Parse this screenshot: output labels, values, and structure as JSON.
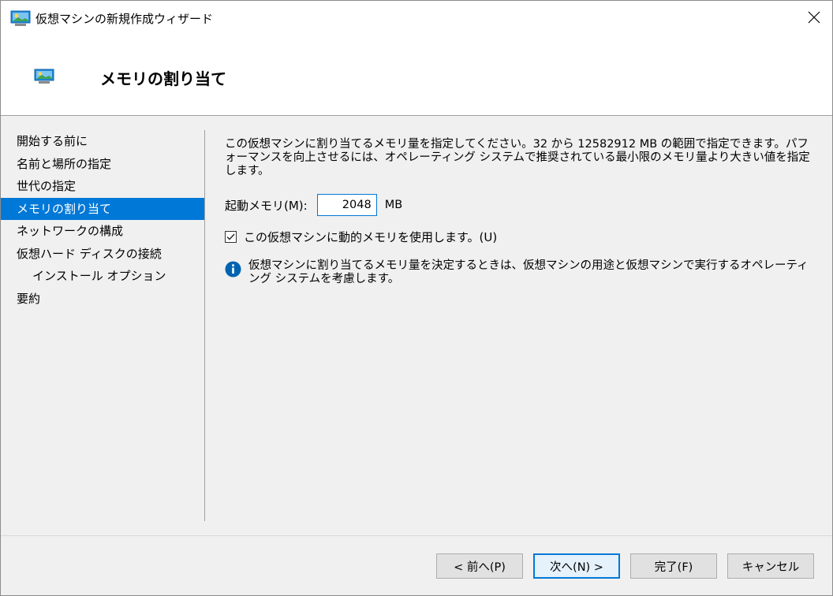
{
  "window": {
    "title": "仮想マシンの新規作成ウィザード",
    "close_glyph": "✕"
  },
  "header": {
    "title": "メモリの割り当て"
  },
  "nav": {
    "items": [
      {
        "label": "開始する前に",
        "selected": false,
        "indent": false
      },
      {
        "label": "名前と場所の指定",
        "selected": false,
        "indent": false
      },
      {
        "label": "世代の指定",
        "selected": false,
        "indent": false
      },
      {
        "label": "メモリの割り当て",
        "selected": true,
        "indent": false
      },
      {
        "label": "ネットワークの構成",
        "selected": false,
        "indent": false
      },
      {
        "label": "仮想ハード ディスクの接続",
        "selected": false,
        "indent": false
      },
      {
        "label": "インストール オプション",
        "selected": false,
        "indent": true
      },
      {
        "label": "要約",
        "selected": false,
        "indent": false
      }
    ]
  },
  "content": {
    "description": "この仮想マシンに割り当てるメモリ量を指定してください。32 から 12582912 MB の範囲で指定できます。パフォーマンスを向上させるには、オペレーティング システムで推奨されている最小限のメモリ量より大きい値を指定します。",
    "startup_memory_label": "起動メモリ(M):",
    "startup_memory_value": "2048",
    "startup_memory_unit": "MB",
    "dynamic_memory_label": "この仮想マシンに動的メモリを使用します。(U)",
    "dynamic_memory_checked": true,
    "info_text": "仮想マシンに割り当てるメモリ量を決定するときは、仮想マシンの用途と仮想マシンで実行するオペレーティング システムを考慮します。"
  },
  "buttons": {
    "previous": "< 前へ(P)",
    "next": "次へ(N) >",
    "finish": "完了(F)",
    "cancel": "キャンセル"
  },
  "colors": {
    "accent": "#0078d7",
    "window_bg": "#f0f0f0",
    "header_bg": "#ffffff",
    "info_icon": "#0063b1"
  },
  "icons": {
    "title": "vm-monitor-icon",
    "header": "vm-monitor-icon",
    "info": "info-icon",
    "close": "close-icon",
    "check": "checkmark-icon"
  }
}
